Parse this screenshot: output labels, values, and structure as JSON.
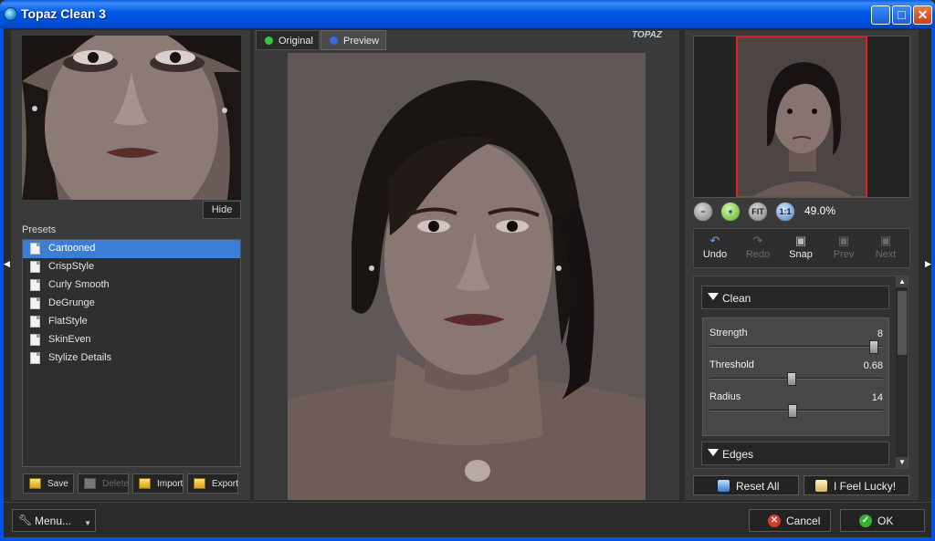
{
  "window": {
    "title": "Topaz Clean 3"
  },
  "left": {
    "hide_label": "Hide",
    "presets_label": "Presets",
    "presets": [
      {
        "label": "Cartooned",
        "selected": true
      },
      {
        "label": "CrispStyle",
        "selected": false
      },
      {
        "label": "Curly Smooth",
        "selected": false
      },
      {
        "label": "DeGrunge",
        "selected": false
      },
      {
        "label": "FlatStyle",
        "selected": false
      },
      {
        "label": "SkinEven",
        "selected": false
      },
      {
        "label": "Stylize Details",
        "selected": false
      }
    ],
    "buttons": {
      "save": "Save",
      "delete": "Delete",
      "import": "Import",
      "export": "Export"
    }
  },
  "center": {
    "tabs": {
      "original": "Original",
      "preview": "Preview"
    },
    "logo_text": "TOPAZ"
  },
  "right": {
    "zoom": "49.0%",
    "zoom_buttons": {
      "fit": "FIT",
      "one_to_one": "1:1"
    },
    "history": {
      "undo": "Undo",
      "redo": "Redo",
      "snap": "Snap",
      "prev": "Prev",
      "next": "Next"
    },
    "sections": {
      "clean": "Clean",
      "edges": "Edges"
    },
    "sliders": [
      {
        "name": "Strength",
        "value": "8",
        "fraction": 0.97
      },
      {
        "name": "Threshold",
        "value": "0.68",
        "fraction": 0.47
      },
      {
        "name": "Radius",
        "value": "14",
        "fraction": 0.48
      }
    ],
    "reset_all": "Reset All",
    "feel_lucky": "I Feel Lucky!"
  },
  "bottom": {
    "menu": "Menu...",
    "cancel": "Cancel",
    "ok": "OK"
  },
  "colors": {
    "title_bar": "#0058e6",
    "selection": "#3c7dd8",
    "nav_frame": "#e02020",
    "panel_bg": "#3a3a3a"
  }
}
